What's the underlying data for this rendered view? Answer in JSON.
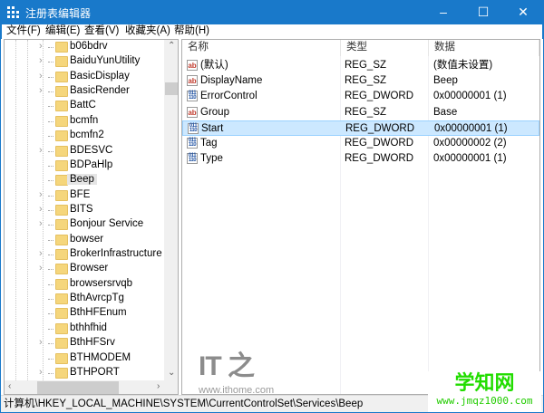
{
  "window": {
    "title": "注册表编辑器",
    "minimize": "–",
    "maximize": "☐",
    "close": "✕"
  },
  "menu": [
    "文件(F)",
    "编辑(E)",
    "查看(V)",
    "收藏夹(A)",
    "帮助(H)"
  ],
  "tree": {
    "items": [
      {
        "label": "b06bdrv",
        "expandable": true
      },
      {
        "label": "BaiduYunUtility",
        "expandable": true
      },
      {
        "label": "BasicDisplay",
        "expandable": true
      },
      {
        "label": "BasicRender",
        "expandable": true
      },
      {
        "label": "BattC",
        "expandable": false
      },
      {
        "label": "bcmfn",
        "expandable": false
      },
      {
        "label": "bcmfn2",
        "expandable": false
      },
      {
        "label": "BDESVC",
        "expandable": true
      },
      {
        "label": "BDPaHlp",
        "expandable": false
      },
      {
        "label": "Beep",
        "expandable": false,
        "selected": true
      },
      {
        "label": "BFE",
        "expandable": true
      },
      {
        "label": "BITS",
        "expandable": true
      },
      {
        "label": "Bonjour Service",
        "expandable": true
      },
      {
        "label": "bowser",
        "expandable": false
      },
      {
        "label": "BrokerInfrastructure",
        "expandable": true
      },
      {
        "label": "Browser",
        "expandable": true
      },
      {
        "label": "browsersrvqb",
        "expandable": false
      },
      {
        "label": "BthAvrcpTg",
        "expandable": false
      },
      {
        "label": "BthHFEnum",
        "expandable": false
      },
      {
        "label": "bthhfhid",
        "expandable": false
      },
      {
        "label": "BthHFSrv",
        "expandable": true
      },
      {
        "label": "BTHMODEM",
        "expandable": false
      },
      {
        "label": "BTHPORT",
        "expandable": true
      }
    ]
  },
  "list": {
    "columns": [
      "名称",
      "类型",
      "数据"
    ],
    "rows": [
      {
        "icon": "ab",
        "name": "(默认)",
        "type": "REG_SZ",
        "data": "(数值未设置)"
      },
      {
        "icon": "ab",
        "name": "DisplayName",
        "type": "REG_SZ",
        "data": "Beep"
      },
      {
        "icon": "dword",
        "name": "ErrorControl",
        "type": "REG_DWORD",
        "data": "0x00000001 (1)"
      },
      {
        "icon": "ab",
        "name": "Group",
        "type": "REG_SZ",
        "data": "Base"
      },
      {
        "icon": "dword",
        "name": "Start",
        "type": "REG_DWORD",
        "data": "0x00000001 (1)",
        "selected": true
      },
      {
        "icon": "dword",
        "name": "Tag",
        "type": "REG_DWORD",
        "data": "0x00000002 (2)"
      },
      {
        "icon": "dword",
        "name": "Type",
        "type": "REG_DWORD",
        "data": "0x00000001 (1)"
      }
    ]
  },
  "status": "计算机\\HKEY_LOCAL_MACHINE\\SYSTEM\\CurrentControlSet\\Services\\Beep",
  "watermark": {
    "logo": "IT之家",
    "url": "www.ithome.com"
  },
  "badge": {
    "title": "学知网",
    "url": "www.jmqz1000.com"
  }
}
